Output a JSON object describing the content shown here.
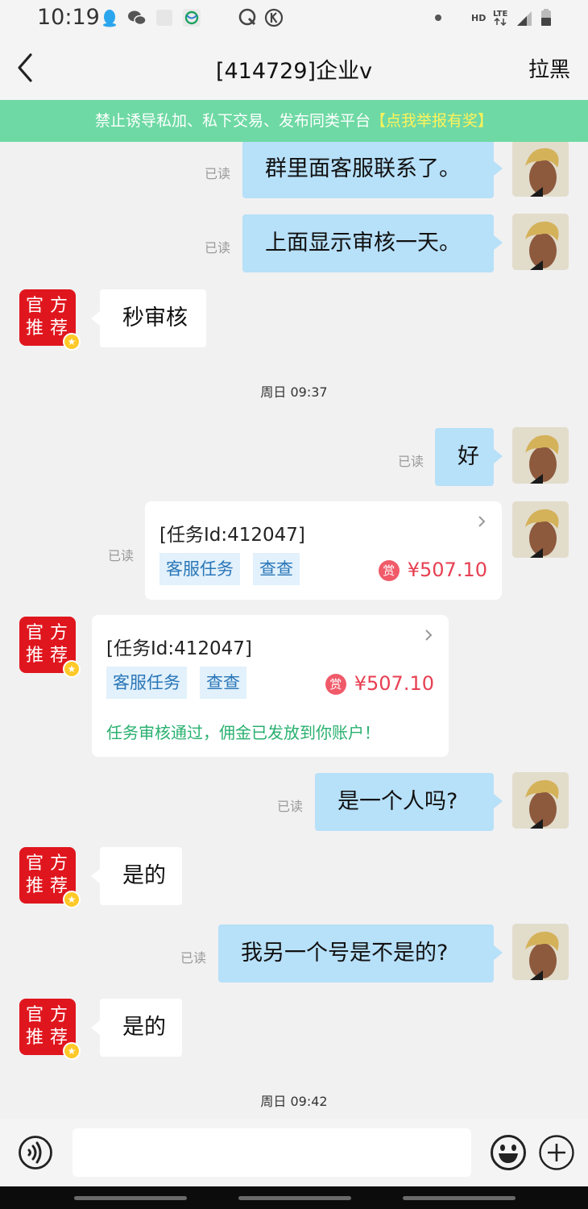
{
  "status": {
    "time": "10:19"
  },
  "header": {
    "title": "[414729]企业v",
    "block_label": "拉黑"
  },
  "notice": {
    "text": "禁止诱导私加、私下交易、发布同类平台",
    "link": "【点我举报有奖】"
  },
  "official_avatar": {
    "line1": [
      "官",
      "方"
    ],
    "line2": [
      "推",
      "荐"
    ]
  },
  "read_label": "已读",
  "messages": [
    {
      "from": "me",
      "text": "群里面客服联系了。"
    },
    {
      "from": "me",
      "text": "上面显示审核一天。"
    },
    {
      "from": "them",
      "text": "秒审核"
    },
    {
      "time": "周日 09:37"
    },
    {
      "from": "me",
      "text": "好"
    },
    {
      "from": "me",
      "card": {
        "id": "[任务Id:412047]",
        "tags": [
          "客服任务",
          "查查"
        ],
        "badge": "赏",
        "amount": "¥507.10"
      }
    },
    {
      "from": "them",
      "card": {
        "id": "[任务Id:412047]",
        "tags": [
          "客服任务",
          "查查"
        ],
        "badge": "赏",
        "amount": "¥507.10",
        "note": "任务审核通过，佣金已发放到你账户！"
      }
    },
    {
      "from": "me",
      "text": "是一个人吗?"
    },
    {
      "from": "them",
      "text": "是的"
    },
    {
      "from": "me",
      "text": "我另一个号是不是的?"
    },
    {
      "from": "them",
      "text": "是的"
    },
    {
      "time": "周日 09:42"
    }
  ],
  "colors": {
    "notice_bg": "#6ed9a4",
    "my_bubble": "#b7e0f9",
    "reward": "#e74052",
    "approved": "#29b06f",
    "official_avatar": "#e0161e"
  }
}
